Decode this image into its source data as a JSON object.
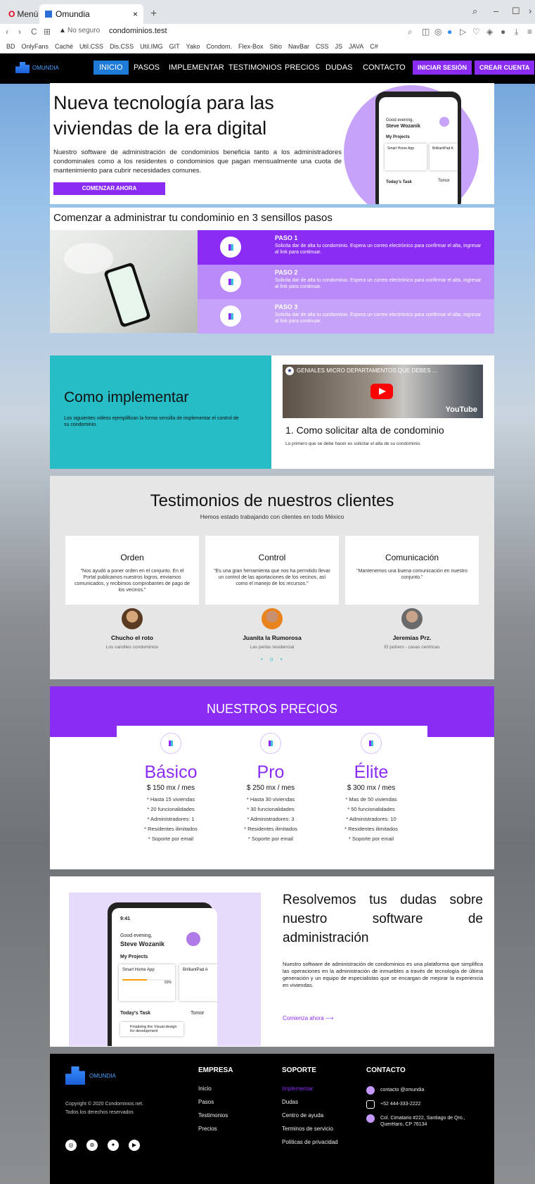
{
  "browser": {
    "menu_label": "Menú",
    "tab_title": "Omundia",
    "tab_close": "×",
    "tab_add": "+",
    "not_secure": "No seguro",
    "url": "condominios.test",
    "bookmarks": [
      "BD",
      "OnlyFans",
      "Caché",
      "Util.CSS",
      "Dis.CSS",
      "Util.IMG",
      "GIT",
      "Yako",
      "Condom.",
      "Flex-Box",
      "Sitio",
      "NavBar",
      "CSS",
      "JS",
      "JAVA",
      "C#"
    ]
  },
  "nav": {
    "brand": "OMUNDIA",
    "links": [
      "INICIO",
      "PASOS",
      "IMPLEMENTAR",
      "TESTIMONIOS",
      "PRECIOS",
      "DUDAS",
      "CONTACTO"
    ],
    "login": "INICIAR SESIÓN",
    "signup": "CREAR CUENTA"
  },
  "hero": {
    "title": "Nueva tecnología para las viviendas de la era digital",
    "text": "Nuestro software de administración de condominios beneficia tanto a los administradores condominales como a los residentes o condominios que pagan mensualmente una cuota de mantenimiento para cubrir necesidades comunes.",
    "button": "COMENZAR AHORA",
    "phone": {
      "greeting": "Good evening,",
      "user": "Steve Wozanik",
      "projects": "My Projects",
      "card1": "Smart Home App",
      "card2": "BrilliantPad A",
      "today": "Today's Task",
      "tomorrow": "Tomor"
    }
  },
  "steps": {
    "title": "Comenzar a administrar tu condominio en 3 sensillos pasos",
    "items": [
      {
        "title": "PASO 1",
        "text": "Solicita dar de alta tu condominio. Espera un correo electrónico para confirmar el alta, ingresar al link para continuar."
      },
      {
        "title": "PASO 2",
        "text": "Solicita dar de alta tu condominio. Espera un correo electrónico para confirmar el alta, ingresar al link para continuar."
      },
      {
        "title": "PASO 3",
        "text": "Solicita dar de alta tu condominio. Espera un correo electrónico para confirmar el alta, ingresar al link para continuar."
      }
    ]
  },
  "implement": {
    "title": "Como implementar",
    "text": "Los siguientes videos ejemplifican la forma sensilla de implementar el control de su condominio.",
    "video_title": "GENIALES MICRO DEPARTAMENTOS QUE DEBES ...",
    "video_brand": "YouTube",
    "item_title": "1. Como solicitar alta de condominio",
    "item_text": "Lo primero que se debe hacer es solicitar el alta de su condominio."
  },
  "testimonials": {
    "title": "Testimonios de nuestros clientes",
    "subtitle": "Hemos estado trabajando con clientes en todo México",
    "items": [
      {
        "heading": "Orden",
        "quote": "\"Nos ayudó a poner orden en el conjunto. En el Portal publicamos nuestros logros, enviamos comunicados, y recibimos comprobantes de pago de los vecinos.\"",
        "name": "Chucho el roto",
        "org": "Los candiles condominios"
      },
      {
        "heading": "Control",
        "quote": "\"Es una gran herramienta que nos ha permitido llevar un control de las aportaciones de los vecinos, así como el manejo de los recursos.\"",
        "name": "Juanita la Rumorosa",
        "org": "Las perlas residencial"
      },
      {
        "heading": "Comunicación",
        "quote": "\"Mantenemos una buena comunicación en nuestro conjunto.\"",
        "name": "Jeremias Prz.",
        "org": "El potrero - casas centricas"
      }
    ],
    "dots": "• o •"
  },
  "prices": {
    "title": "NUESTROS PRECIOS",
    "plans": [
      {
        "name": "Básico",
        "price": "$ 150 mx / mes",
        "features": [
          "* Hasta 15 viviendas",
          "* 20 funcionalidades",
          "* Administradores: 1",
          "* Residentes ilimitados",
          "* Soporte por email"
        ]
      },
      {
        "name": "Pro",
        "price": "$ 250 mx / mes",
        "features": [
          "* Hasta 30 viviendas",
          "* 30 funcionalidades",
          "* Administradores: 3",
          "* Residentes ilimitados",
          "* Soporte por email"
        ]
      },
      {
        "name": "Élite",
        "price": "$ 300 mx / mes",
        "features": [
          "* Mas de 50 viviendas",
          "* 50 funcionalidades",
          "* Administradores: 10",
          "* Residentes ilimitados",
          "* Soporte por email"
        ]
      }
    ]
  },
  "faq": {
    "title": "Resolvemos tus dudas sobre nuestro software de administración",
    "text": "Nuestro software de administración de condominios es una plataforma que simplifica las operaciones en la administración de inmuebles a través de tecnología de última generación y un equipo de especialistas que se encargan de mejorar la experiencia en viviendas.",
    "link": "Comienza ahora  ⟶",
    "phone": {
      "time": "9:41",
      "greeting": "Good evening,",
      "user": "Steve Wozanik",
      "projects": "My Projects",
      "card1": "Smart Home App",
      "card2": "BrilliantPad A",
      "percent": "50%",
      "today": "Today's Task",
      "tomorrow": "Tomor",
      "task1": "Finalizing the Visual design for development"
    }
  },
  "footer": {
    "brand": "OMUNDIA",
    "copyright": "Copyright © 2020 Condominios.net.",
    "rights": "Todos los derechos reservados",
    "empresa": {
      "title": "EMPRESA",
      "links": [
        "Inicio",
        "Pasos",
        "Testimonios",
        "Precios"
      ]
    },
    "soporte": {
      "title": "SOPORTE",
      "links": [
        "Implementar",
        "Dudas",
        "Centro de ayuda",
        "Terminos de servicio",
        "Politicas de privacidad"
      ]
    },
    "contacto": {
      "title": "CONTACTO",
      "email": "contacto @omundia",
      "phone": "+52 444-333-2222",
      "address": "Col. Cimatario #222, Santiago de Qro., Querétaro, CP 76134"
    }
  },
  "colors": {
    "purple": "#8b2cf5",
    "teal": "#27bdc6",
    "lavender": "#c7a2f9"
  }
}
